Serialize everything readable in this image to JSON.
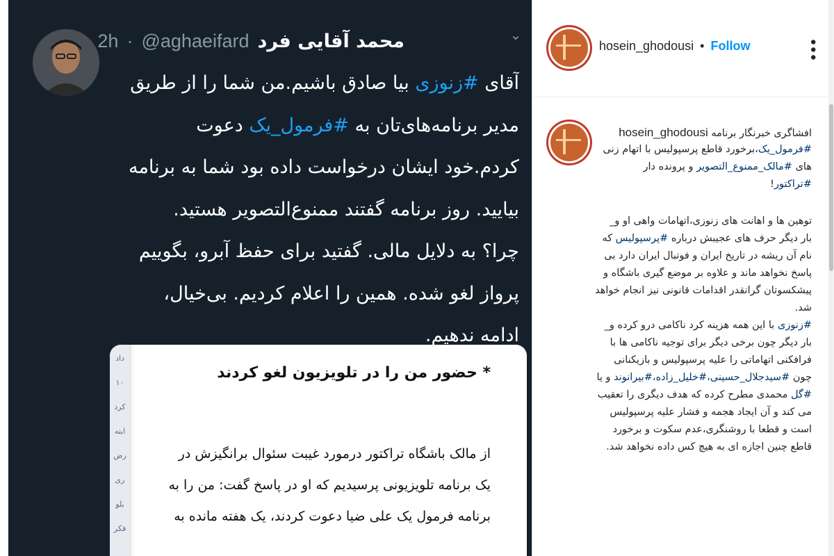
{
  "tweet": {
    "display_name": "محمد آقایی فرد",
    "handle": "@aghaeifard",
    "separator": "·",
    "time": "2h",
    "menu_icon": "chevron-down-icon",
    "lines": [
      {
        "pre": "آقای ",
        "tag": "#زنوزی",
        "post": " بیا صادق باشیم.من شما را از طریق"
      },
      {
        "pre": "مدیر برنامه‌های‌تان به ",
        "tag": "#فرمول_یک",
        "post": " دعوت"
      },
      {
        "pre": "کردم.خود ایشان درخواست داده بود شما به برنامه",
        "tag": "",
        "post": ""
      },
      {
        "pre": "بیایید. روز برنامه گفتند ممنوع‌التصویر هستید.",
        "tag": "",
        "post": ""
      },
      {
        "pre": "چرا؟ به دلایل مالی. گفتید برای حفظ آبرو، بگوییم",
        "tag": "",
        "post": ""
      },
      {
        "pre": "پرواز لغو شده. همین را اعلام کردیم. بی‌خیال،",
        "tag": "",
        "post": ""
      },
      {
        "pre": "ادامه ندهیم.",
        "tag": "",
        "post": ""
      }
    ],
    "embed": {
      "title": "* حضور من را در تلویزیون لغو کردند",
      "sidebar_items": [
        "داد",
        "۱۰",
        "کرد",
        "ابته",
        "رض",
        "ری",
        "بلو",
        "فکر"
      ],
      "lines": [
        "از مالک باشگاه تراکتور درمورد غیبت سئوال برانگیزش در",
        "یک برنامه تلویزیونی پرسیدیم که او در  پاسخ گفت: من را به",
        "برنامه فرمول یک علی ضیا دعوت کردند، یک هفته مانده به"
      ]
    }
  },
  "instagram": {
    "username": "hosein_ghodousi",
    "dot": "•",
    "follow_label": "Follow",
    "more_icon": "more-options-icon",
    "caption_username": "hosein_ghodousi",
    "caption_lines": [
      {
        "pre": "افشاگری خبرنگار برنامه",
        "tag": "",
        "post": "",
        "user": true
      },
      {
        "pre": "",
        "tag": "#فرمول_یک",
        "post": "،برخورد قاطع پرسپولیس با اتهام زنی"
      },
      {
        "pre": "های ",
        "tag": "#مالک_ممنوع_التصویر",
        "post": " و پرونده دار"
      },
      {
        "pre": "",
        "tag": "#تراکتور",
        "post": "!"
      }
    ],
    "body_lines": [
      {
        "pre": "توهین ها و اهانت های زنوزی،اتهامات واهی او و_",
        "tag": "",
        "post": ""
      },
      {
        "pre": "بار دیگر حرف های عجیبش درباره ",
        "tag": "#پرسپولیس",
        "post": " که"
      },
      {
        "pre": "نام آن ریشه در تاریخ ایران و فوتبال ایران دارد بی",
        "tag": "",
        "post": ""
      },
      {
        "pre": "پاسخ نخواهد ماند و علاوه بر موضع گیری باشگاه و",
        "tag": "",
        "post": ""
      },
      {
        "pre": "پیشکسوتان گرانقدر اقدامات قانونی نیز انجام خواهد",
        "tag": "",
        "post": ""
      },
      {
        "pre": "شد.",
        "tag": "",
        "post": ""
      },
      {
        "pre": "",
        "tag": "#زنوزی",
        "post": " با این همه هزینه کرد ناکامی درو کرده و_"
      },
      {
        "pre": "بار دیگر چون برخی دیگر برای توجیه ناکامی ها با",
        "tag": "",
        "post": ""
      },
      {
        "pre": "فرافکنی اتهاماتی را علیه پرسپولیس و بازیکنانی",
        "tag": "",
        "post": ""
      },
      {
        "pre": "چون ",
        "tag": "#سیدجلال_حسینی،#خلیل_زاده،#بیرانوند",
        "post": " و یا"
      },
      {
        "pre": "",
        "tag": "#گل",
        "post": " محمدی مطرح کرده که هدف دیگری را تعقیب"
      },
      {
        "pre": "می کند و آن ایجاد هجمه و فشار علیه پرسپولیس",
        "tag": "",
        "post": ""
      },
      {
        "pre": "است و قطعا با روشنگری،عدم سکوت و برخورد",
        "tag": "",
        "post": ""
      },
      {
        "pre": "قاطع چنین اجازه ای به هیچ کس داده نخواهد شد.",
        "tag": "",
        "post": ""
      }
    ]
  }
}
